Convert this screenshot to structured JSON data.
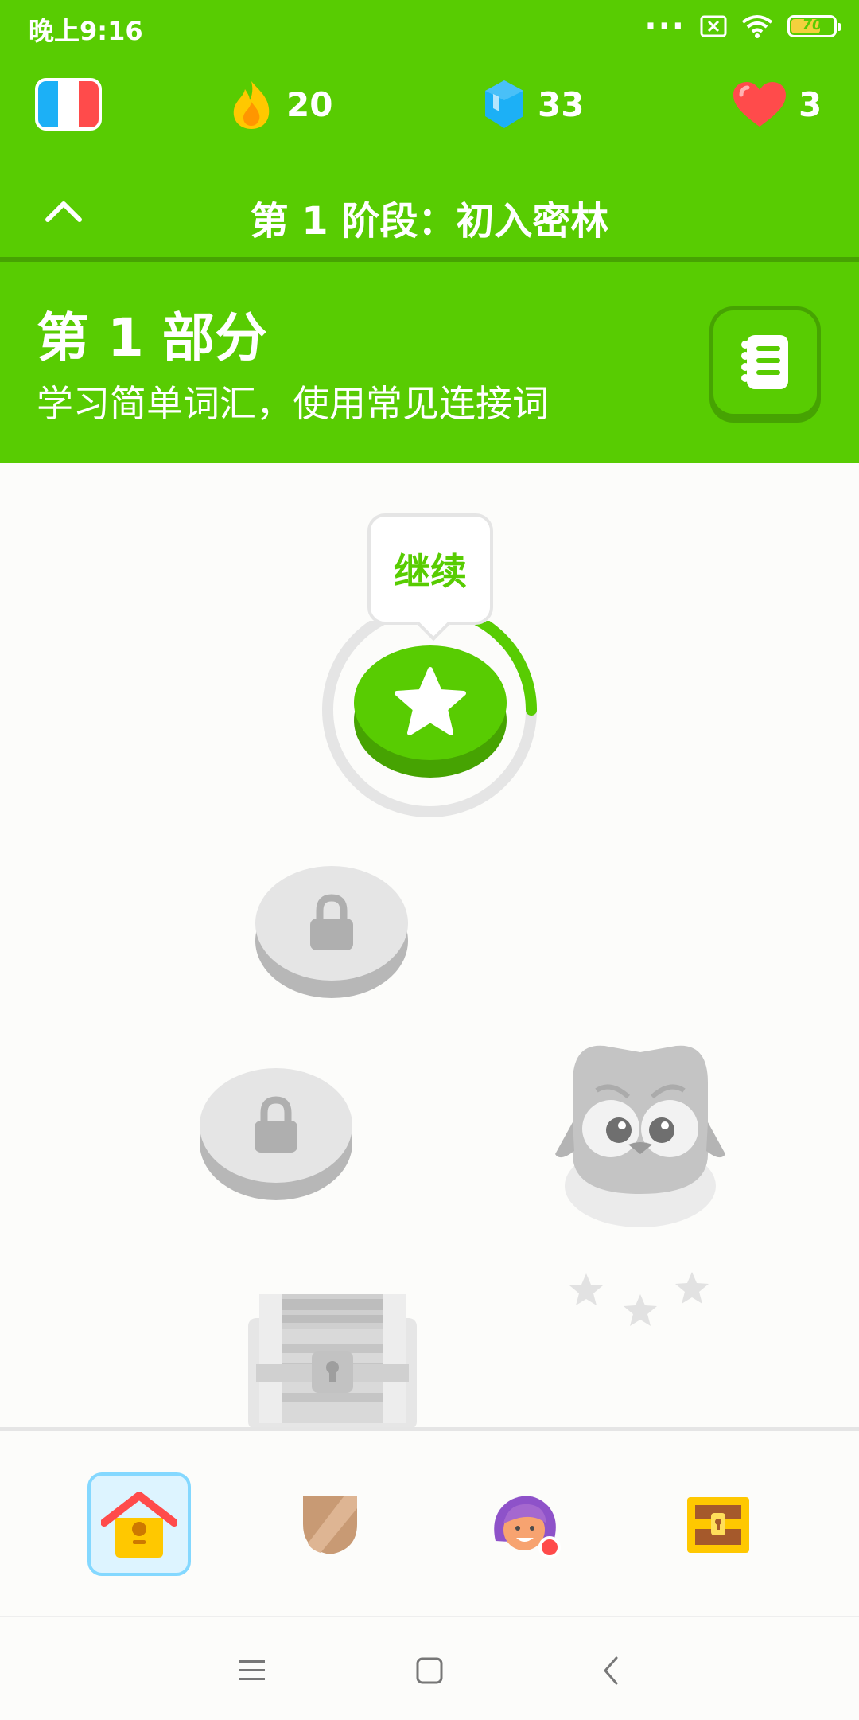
{
  "status_bar": {
    "time": "晚上9:16",
    "battery": "70",
    "icons": [
      "more-dots-icon",
      "sim-none-icon",
      "wifi-icon",
      "battery-icon"
    ]
  },
  "stats": {
    "course_flag": "france-flag-icon",
    "streak": "20",
    "gems": "33",
    "hearts": "3"
  },
  "unit": {
    "title": "第 1 阶段：初入密林"
  },
  "section": {
    "title": "第 1 部分",
    "subtitle": "学习简单词汇，使用常见连接词"
  },
  "path": {
    "tooltip": "继续",
    "progress_fraction": 0.25,
    "nodes": [
      {
        "state": "active",
        "icon": "star-icon"
      },
      {
        "state": "locked",
        "icon": "lock-icon"
      },
      {
        "state": "locked",
        "icon": "lock-icon"
      },
      {
        "state": "locked",
        "icon": "chest-icon"
      }
    ]
  },
  "bottom_nav": [
    {
      "name": "home",
      "icon": "house-icon",
      "active": true
    },
    {
      "name": "leagues",
      "icon": "shield-icon",
      "active": false
    },
    {
      "name": "profile",
      "icon": "avatar-icon",
      "active": false
    },
    {
      "name": "shop",
      "icon": "shop-chest-icon",
      "active": false
    }
  ],
  "colors": {
    "brand_green": "#58cc02",
    "dark_green": "#46a302",
    "locked_gray": "#e5e5e5",
    "nav_active_bg": "#ddf4ff"
  }
}
